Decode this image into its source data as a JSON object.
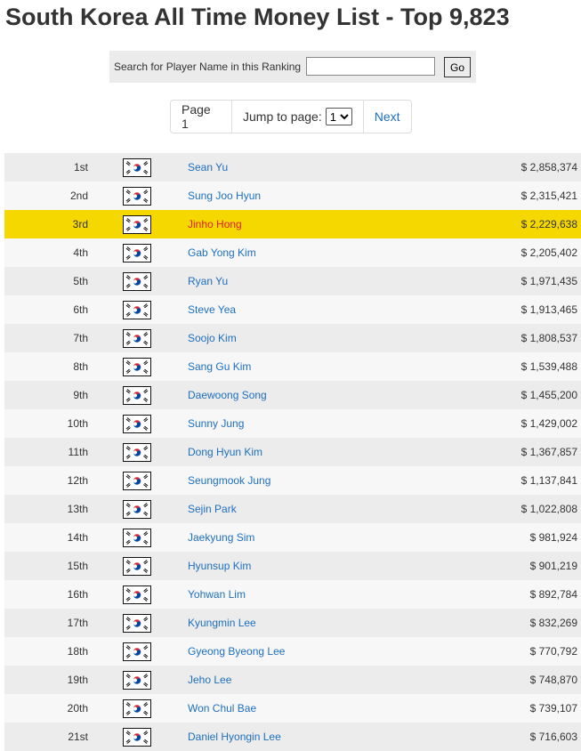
{
  "page": {
    "title": "South Korea All Time Money List - Top 9,823"
  },
  "search": {
    "label": "Search for Player Name in this Ranking",
    "value": "",
    "placeholder": "",
    "go_label": "Go"
  },
  "pager": {
    "page_label": "Page 1",
    "jump_label": "Jump to page:",
    "jump_selected": "1",
    "next_label": "Next"
  },
  "colors": {
    "highlight_row": "#f5d800",
    "link": "#1e6fbf",
    "highlight_link": "#e0201c"
  },
  "rows": [
    {
      "rank": "1st",
      "flag": "south-korea-flag-icon",
      "name": "Sean Yu",
      "money": "$ 2,858,374"
    },
    {
      "rank": "2nd",
      "flag": "south-korea-flag-icon",
      "name": "Sung Joo Hyun",
      "money": "$ 2,315,421"
    },
    {
      "rank": "3rd",
      "flag": "south-korea-flag-icon",
      "name": "Jinho Hong",
      "money": "$ 2,229,638",
      "highlight": true
    },
    {
      "rank": "4th",
      "flag": "south-korea-flag-icon",
      "name": "Gab Yong Kim",
      "money": "$ 2,205,402"
    },
    {
      "rank": "5th",
      "flag": "south-korea-flag-icon",
      "name": "Ryan Yu",
      "money": "$ 1,971,435"
    },
    {
      "rank": "6th",
      "flag": "south-korea-flag-icon",
      "name": "Steve Yea",
      "money": "$ 1,913,465"
    },
    {
      "rank": "7th",
      "flag": "south-korea-flag-icon",
      "name": "Soojo Kim",
      "money": "$ 1,808,537"
    },
    {
      "rank": "8th",
      "flag": "south-korea-flag-icon",
      "name": "Sang Gu Kim",
      "money": "$ 1,539,488"
    },
    {
      "rank": "9th",
      "flag": "south-korea-flag-icon",
      "name": "Daewoong Song",
      "money": "$ 1,455,200"
    },
    {
      "rank": "10th",
      "flag": "south-korea-flag-icon",
      "name": "Sunny Jung",
      "money": "$ 1,429,002"
    },
    {
      "rank": "11th",
      "flag": "south-korea-flag-icon",
      "name": "Dong Hyun Kim",
      "money": "$ 1,367,857"
    },
    {
      "rank": "12th",
      "flag": "south-korea-flag-icon",
      "name": "Seungmook Jung",
      "money": "$ 1,137,841"
    },
    {
      "rank": "13th",
      "flag": "south-korea-flag-icon",
      "name": "Sejin Park",
      "money": "$ 1,022,808"
    },
    {
      "rank": "14th",
      "flag": "south-korea-flag-icon",
      "name": "Jaekyung Sim",
      "money": "$ 981,924"
    },
    {
      "rank": "15th",
      "flag": "south-korea-flag-icon",
      "name": "Hyunsup Kim",
      "money": "$ 901,219"
    },
    {
      "rank": "16th",
      "flag": "south-korea-flag-icon",
      "name": "Yohwan Lim",
      "money": "$ 892,784"
    },
    {
      "rank": "17th",
      "flag": "south-korea-flag-icon",
      "name": "Kyungmin Lee",
      "money": "$ 832,269"
    },
    {
      "rank": "18th",
      "flag": "south-korea-flag-icon",
      "name": "Gyeong Byeong Lee",
      "money": "$ 770,792"
    },
    {
      "rank": "19th",
      "flag": "south-korea-flag-icon",
      "name": "Jeho Lee",
      "money": "$ 748,870"
    },
    {
      "rank": "20th",
      "flag": "south-korea-flag-icon",
      "name": "Won Chul Bae",
      "money": "$ 739,107"
    },
    {
      "rank": "21st",
      "flag": "south-korea-flag-icon",
      "name": "Daniel Hyongin Lee",
      "money": "$ 716,603"
    }
  ]
}
